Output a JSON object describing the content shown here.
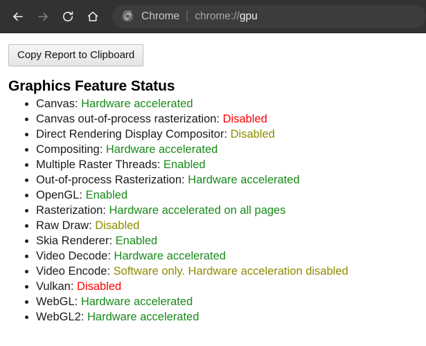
{
  "browser": {
    "nav": {
      "back_label": "Back",
      "forward_label": "Forward",
      "reload_label": "Reload",
      "home_label": "Home"
    },
    "omnibox": {
      "brand": "Chrome",
      "separator": "|",
      "url_prefix": "chrome://",
      "url_host": "gpu",
      "full_url": "chrome://gpu"
    }
  },
  "page": {
    "copy_button_label": "Copy Report to Clipboard",
    "section_title": "Graphics Feature Status",
    "features": [
      {
        "name": "Canvas:",
        "value": "Hardware accelerated",
        "state": "green"
      },
      {
        "name": "Canvas out-of-process rasterization:",
        "value": "Disabled",
        "state": "red"
      },
      {
        "name": "Direct Rendering Display Compositor:",
        "value": "Disabled",
        "state": "olive"
      },
      {
        "name": "Compositing:",
        "value": "Hardware accelerated",
        "state": "green"
      },
      {
        "name": "Multiple Raster Threads:",
        "value": "Enabled",
        "state": "green"
      },
      {
        "name": "Out-of-process Rasterization:",
        "value": "Hardware accelerated",
        "state": "green"
      },
      {
        "name": "OpenGL:",
        "value": "Enabled",
        "state": "green"
      },
      {
        "name": "Rasterization:",
        "value": "Hardware accelerated on all pages",
        "state": "green"
      },
      {
        "name": "Raw Draw:",
        "value": "Disabled",
        "state": "olive"
      },
      {
        "name": "Skia Renderer:",
        "value": "Enabled",
        "state": "green"
      },
      {
        "name": "Video Decode:",
        "value": "Hardware accelerated",
        "state": "green"
      },
      {
        "name": "Video Encode:",
        "value": "Software only. Hardware acceleration disabled",
        "state": "olive"
      },
      {
        "name": "Vulkan:",
        "value": "Disabled",
        "state": "red"
      },
      {
        "name": "WebGL:",
        "value": "Hardware accelerated",
        "state": "green"
      },
      {
        "name": "WebGL2:",
        "value": "Hardware accelerated",
        "state": "green"
      }
    ]
  },
  "colors": {
    "toolbar_bg": "#323232",
    "omnibox_bg": "#3c3c3c",
    "green": "#188a18",
    "red": "#ff0000",
    "olive": "#8b8b00"
  }
}
